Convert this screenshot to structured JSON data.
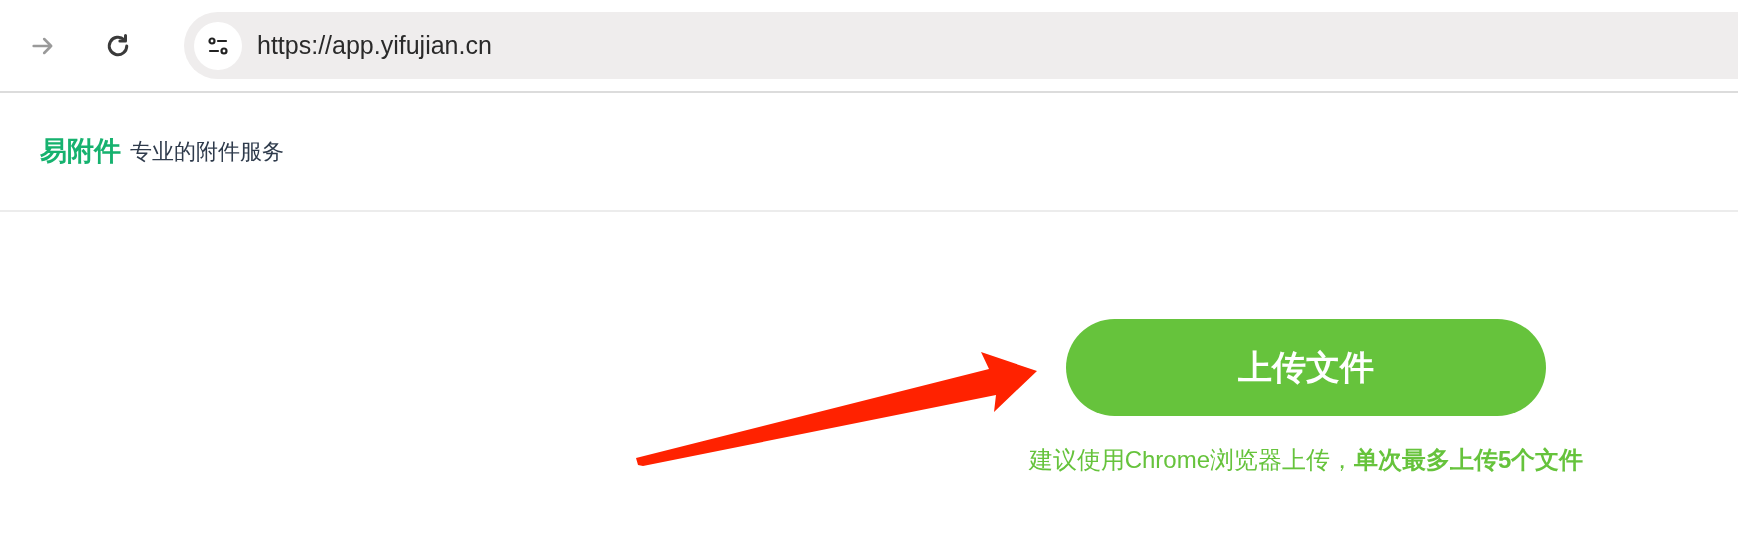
{
  "browser": {
    "url": "https://app.yifujian.cn",
    "forward_disabled": true
  },
  "header": {
    "logo": "易附件",
    "tagline": "专业的附件服务"
  },
  "upload_button": {
    "label": "上传文件"
  },
  "hint": "建议使用Chrome浏览器上传，**单次最多上传5个文件**"
}
